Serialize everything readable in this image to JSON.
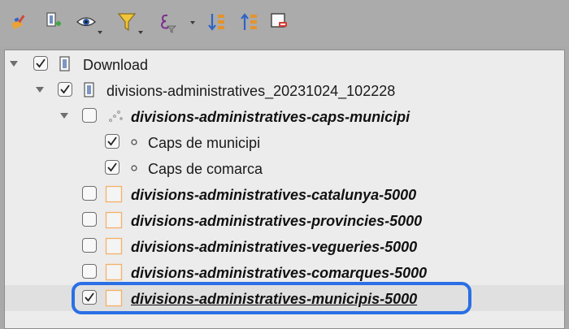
{
  "toolbar": {
    "buttons": [
      {
        "name": "style-manager-icon"
      },
      {
        "name": "add-group-icon"
      },
      {
        "name": "visibility-eye-icon",
        "has_menu": true
      },
      {
        "name": "filter-funnel-icon",
        "has_menu": true
      },
      {
        "name": "filter-expression-icon",
        "has_menu": true
      },
      {
        "name": "expand-all-icon"
      },
      {
        "name": "collapse-all-icon"
      },
      {
        "name": "remove-layer-icon"
      }
    ]
  },
  "tree": {
    "rows": [
      {
        "label": "Download",
        "type": "group",
        "checked": true,
        "expanded": true
      },
      {
        "label": "divisions-administratives_20231024_102228",
        "type": "group",
        "checked": true,
        "expanded": true
      },
      {
        "label": "divisions-administratives-caps-municipi",
        "type": "point-layer",
        "checked": false,
        "expanded": true
      },
      {
        "label": "Caps de municipi",
        "type": "category",
        "checked": true
      },
      {
        "label": "Caps de comarca",
        "type": "category",
        "checked": true
      },
      {
        "label": "divisions-administratives-catalunya-5000",
        "type": "polygon-layer",
        "checked": false
      },
      {
        "label": "divisions-administratives-provincies-5000",
        "type": "polygon-layer",
        "checked": false
      },
      {
        "label": "divisions-administratives-vegueries-5000",
        "type": "polygon-layer",
        "checked": false
      },
      {
        "label": "divisions-administratives-comarques-5000",
        "type": "polygon-layer",
        "checked": false
      },
      {
        "label": "divisions-administratives-municipis-5000",
        "type": "polygon-layer",
        "checked": true,
        "selected": true
      }
    ]
  },
  "colors": {
    "focus_ring": "#2a6fe5",
    "polygon_outline": "#f3b06a",
    "tree_background": "#ececec",
    "toolbar_background": "#ababab"
  }
}
